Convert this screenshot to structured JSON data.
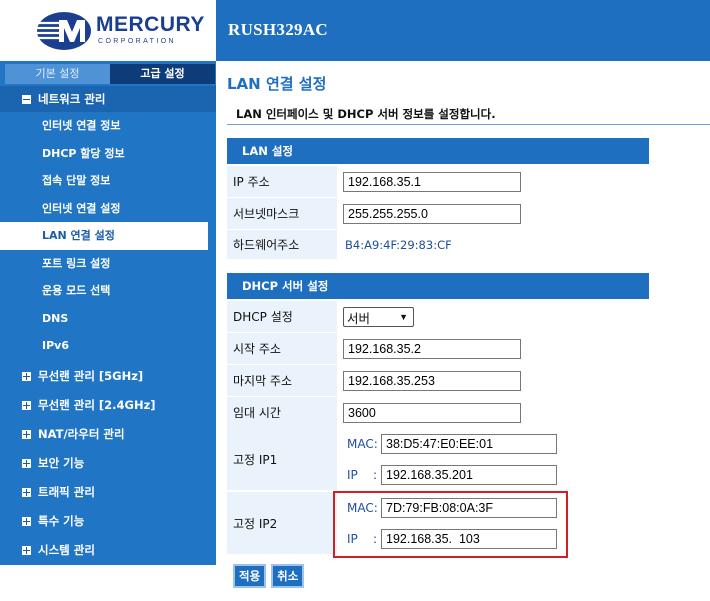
{
  "header": {
    "brand": "MERCURY",
    "brand_sub": "CORPORATION",
    "model": "RUSH329AC"
  },
  "sidebar": {
    "tabs": [
      {
        "label": "기본 설정",
        "active": false
      },
      {
        "label": "고급 설정",
        "active": true
      }
    ],
    "network_group": "네트워크 관리",
    "network_items": [
      {
        "label": "인터넷 연결 정보"
      },
      {
        "label": "DHCP 할당 정보"
      },
      {
        "label": "접속 단말 정보"
      },
      {
        "label": "인터넷 연결 설정"
      },
      {
        "label": "LAN 연결 설정",
        "active": true
      },
      {
        "label": "포트 링크 설정"
      },
      {
        "label": "운용 모드 선택"
      },
      {
        "label": "DNS"
      },
      {
        "label": "IPv6"
      }
    ],
    "groups": [
      {
        "label": "무선랜 관리 [5GHz]"
      },
      {
        "label": "무선랜 관리 [2.4GHz]"
      },
      {
        "label": "NAT/라우터 관리"
      },
      {
        "label": "보안 기능"
      },
      {
        "label": "트래픽 관리"
      },
      {
        "label": "특수 기능"
      },
      {
        "label": "시스템 관리"
      }
    ]
  },
  "main": {
    "title": "LAN 연결 설정",
    "description": "LAN 인터페이스 및 DHCP 서버 정보를 설정합니다."
  },
  "lan": {
    "header": "LAN 설정",
    "ip_label": "IP 주소",
    "ip_value": "192.168.35.1",
    "subnet_label": "서브넷마스크",
    "subnet_value": "255.255.255.0",
    "hw_label": "하드웨어주소",
    "hw_value": "B4:A9:4F:29:83:CF"
  },
  "dhcp": {
    "header": "DHCP 서버 설정",
    "mode_label": "DHCP 설정",
    "mode_value": "서버",
    "start_label": "시작 주소",
    "start_value": "192.168.35.2",
    "end_label": "마지막 주소",
    "end_value": "192.168.35.253",
    "lease_label": "임대 시간",
    "lease_value": "3600",
    "static1": {
      "label": "고정 IP1",
      "mac_tag": "MAC:",
      "mac_value": "38:D5:47:E0:EE:01",
      "ip_tag": "IP    :",
      "ip_value": "192.168.35.201"
    },
    "static2": {
      "label": "고정 IP2",
      "mac_tag": "MAC:",
      "mac_value": "7D:79:FB:08:0A:3F",
      "ip_tag": "IP    :",
      "ip_value": "192.168.35.  103"
    }
  },
  "buttons": {
    "apply": "적용",
    "cancel": "취소"
  },
  "colors": {
    "accent": "#1e6fc0",
    "highlight": "#d21f26"
  }
}
